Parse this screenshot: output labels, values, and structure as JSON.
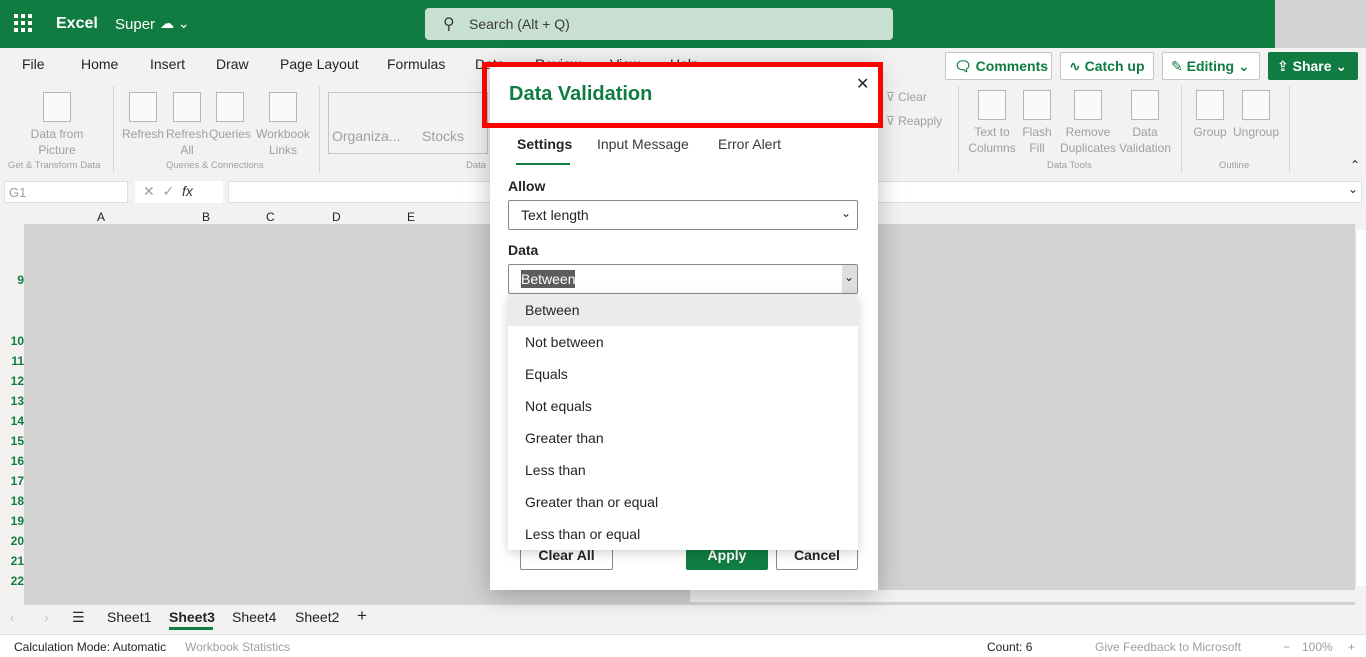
{
  "header": {
    "app_name": "Excel",
    "doc_name": "Super",
    "search_placeholder": "Search (Alt + Q)"
  },
  "ribbon_tabs": [
    "File",
    "Home",
    "Insert",
    "Draw",
    "Page Layout",
    "Formulas",
    "Data",
    "Review",
    "View",
    "Help"
  ],
  "header_buttons": {
    "comments": "Comments",
    "catch_up": "Catch up",
    "editing": "Editing",
    "share": "Share"
  },
  "ribbon": {
    "data_from_picture": "Data from Picture",
    "refresh": "Refresh",
    "refresh_all": "Refresh All",
    "queries": "Queries",
    "workbook_links": "Workbook Links",
    "organization": "Organiza...",
    "stocks": "Stocks",
    "clear": "Clear",
    "reapply": "Reapply",
    "text_to_columns": "Text to Columns",
    "flash_fill": "Flash Fill",
    "remove_duplicates": "Remove Duplicates",
    "data_validation": "Data Validation",
    "group": "Group",
    "ungroup": "Ungroup",
    "groups": {
      "get_transform": "Get & Transform Data",
      "queries_connections": "Queries & Connections",
      "data_types": "Data",
      "data_tools": "Data Tools",
      "outline": "Outline"
    }
  },
  "formula_bar": {
    "name_box": "G1",
    "fx": "fx"
  },
  "columns": [
    "A",
    "B",
    "C",
    "D",
    "E"
  ],
  "rows": [
    "9",
    "10",
    "11",
    "12",
    "13",
    "14",
    "15",
    "16",
    "17",
    "18",
    "19",
    "20",
    "21",
    "22"
  ],
  "dialog": {
    "title": "Data Validation",
    "tabs": [
      "Settings",
      "Input Message",
      "Error Alert"
    ],
    "allow_label": "Allow",
    "allow_value": "Text length",
    "data_label": "Data",
    "data_value": "Between",
    "options": [
      "Between",
      "Not between",
      "Equals",
      "Not equals",
      "Greater than",
      "Less than",
      "Greater than or equal",
      "Less than or equal"
    ],
    "clear_all": "Clear All",
    "apply": "Apply",
    "cancel": "Cancel"
  },
  "sheets": [
    "Sheet1",
    "Sheet3",
    "Sheet4",
    "Sheet2"
  ],
  "active_sheet": "Sheet3",
  "status": {
    "calc_mode": "Calculation Mode: Automatic",
    "workbook_stats": "Workbook Statistics",
    "count": "Count: 6",
    "feedback": "Give Feedback to Microsoft",
    "zoom": "100%"
  },
  "colors": {
    "brand": "#107c41",
    "highlight": "#ff0000"
  }
}
